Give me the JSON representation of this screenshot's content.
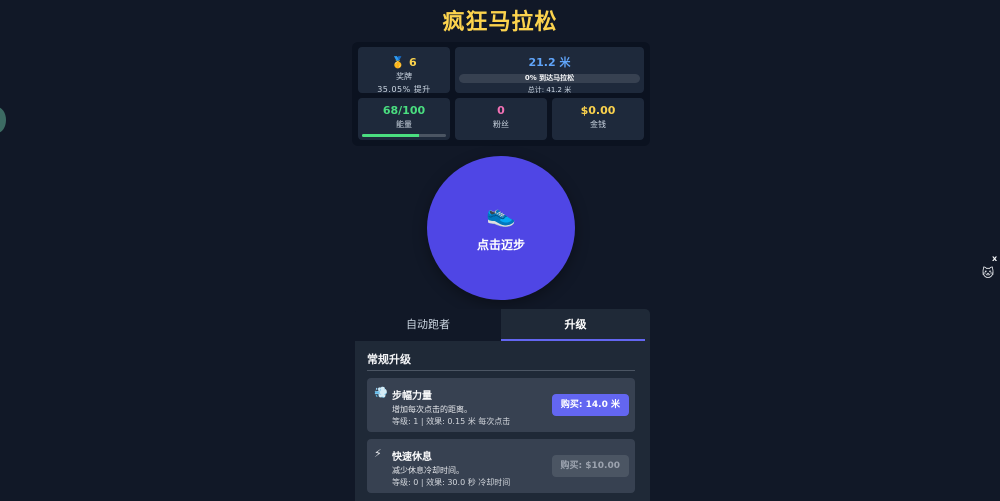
{
  "title": "疯狂马拉松",
  "stats": {
    "medals": {
      "icon": "🥇",
      "value": "6",
      "label": "奖牌",
      "boost": "35.05% 提升"
    },
    "distance": {
      "value": "21.2 米",
      "progress_percent": 0,
      "progress_label": "0% 到达马拉松",
      "total": "总计: 41.2 米"
    },
    "energy": {
      "value": "68/100",
      "label": "能量",
      "fraction": 0.68
    },
    "fans": {
      "value": "0",
      "label": "粉丝"
    },
    "money": {
      "value": "$0.00",
      "label": "金钱"
    }
  },
  "stride_button": {
    "icon": "👟",
    "label": "点击迈步"
  },
  "tabs": [
    {
      "label": "自动跑者",
      "active": false
    },
    {
      "label": "升级",
      "active": true
    }
  ],
  "shop": {
    "section_title": "常规升级",
    "items": [
      {
        "icon": "💨",
        "name": "步幅力量",
        "description": "增加每次点击的距离。",
        "stats": "等级: 1 | 效果: 0.15 米 每次点击",
        "buy_label": "购买: 14.0 米",
        "affordable": true
      },
      {
        "icon": "⚡",
        "name": "快速休息",
        "description": "减少休息冷却时间。",
        "stats": "等级: 0 | 效果: 30.0 秒 冷却时间",
        "buy_label": "购买: $10.00",
        "affordable": false
      }
    ]
  },
  "widget": {
    "close_label": "x",
    "icon": "🐱"
  },
  "colors": {
    "accent": "#6366f1",
    "title": "#fcd34d",
    "energy": "#4ade80",
    "fans": "#f472b6",
    "distance": "#60a5fa"
  }
}
